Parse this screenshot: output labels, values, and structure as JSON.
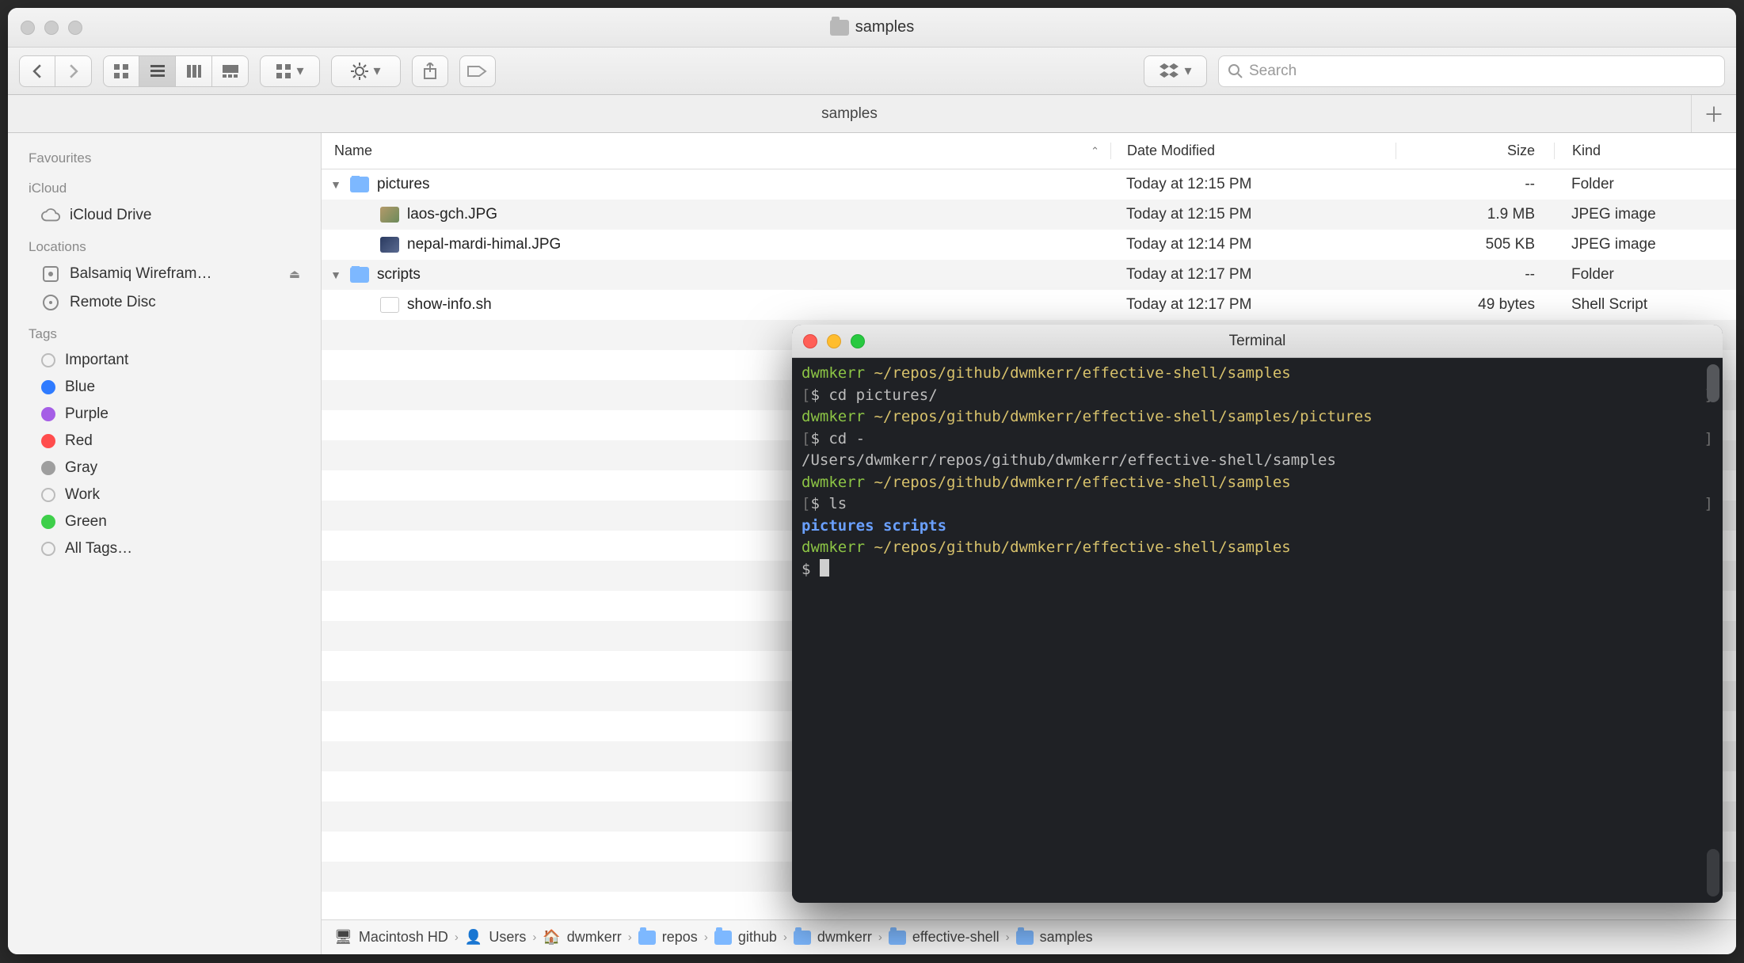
{
  "window": {
    "title": "samples"
  },
  "toolbar": {
    "search_placeholder": "Search"
  },
  "tabbar": {
    "active": "samples"
  },
  "sidebar": {
    "sections": {
      "favourites": "Favourites",
      "icloud": "iCloud",
      "locations": "Locations",
      "tags": "Tags"
    },
    "icloud_items": [
      {
        "label": "iCloud Drive"
      }
    ],
    "location_items": [
      {
        "label": "Balsamiq Wirefram…",
        "ejectable": true
      },
      {
        "label": "Remote Disc"
      }
    ],
    "tag_items": [
      {
        "label": "Important",
        "color": ""
      },
      {
        "label": "Blue",
        "color": "blue"
      },
      {
        "label": "Purple",
        "color": "purple"
      },
      {
        "label": "Red",
        "color": "red"
      },
      {
        "label": "Gray",
        "color": "gray"
      },
      {
        "label": "Work",
        "color": ""
      },
      {
        "label": "Green",
        "color": "green"
      },
      {
        "label": "All Tags…",
        "color": ""
      }
    ]
  },
  "columns": {
    "name": "Name",
    "date": "Date Modified",
    "size": "Size",
    "kind": "Kind"
  },
  "rows": [
    {
      "indent": 0,
      "disclose": "down",
      "icon": "folder",
      "name": "pictures",
      "date": "Today at 12:15 PM",
      "size": "--",
      "kind": "Folder"
    },
    {
      "indent": 1,
      "disclose": "",
      "icon": "img",
      "name": "laos-gch.JPG",
      "date": "Today at 12:15 PM",
      "size": "1.9 MB",
      "kind": "JPEG image"
    },
    {
      "indent": 1,
      "disclose": "",
      "icon": "img2",
      "name": "nepal-mardi-himal.JPG",
      "date": "Today at 12:14 PM",
      "size": "505 KB",
      "kind": "JPEG image"
    },
    {
      "indent": 0,
      "disclose": "down",
      "icon": "folder",
      "name": "scripts",
      "date": "Today at 12:17 PM",
      "size": "--",
      "kind": "Folder"
    },
    {
      "indent": 1,
      "disclose": "",
      "icon": "file",
      "name": "show-info.sh",
      "date": "Today at 12:17 PM",
      "size": "49 bytes",
      "kind": "Shell Script"
    }
  ],
  "path": [
    {
      "icon": "disk",
      "label": "Macintosh HD"
    },
    {
      "icon": "users",
      "label": "Users"
    },
    {
      "icon": "home",
      "label": "dwmkerr"
    },
    {
      "icon": "folder",
      "label": "repos"
    },
    {
      "icon": "folder",
      "label": "github"
    },
    {
      "icon": "folder",
      "label": "dwmkerr"
    },
    {
      "icon": "folder",
      "label": "effective-shell"
    },
    {
      "icon": "folder",
      "label": "samples"
    }
  ],
  "terminal": {
    "title": "Terminal",
    "user": "dwmkerr",
    "lines": {
      "p1_path": "~/repos/github/dwmkerr/effective-shell/samples",
      "c1": "cd pictures/",
      "p2_path": "~/repos/github/dwmkerr/effective-shell/samples/pictures",
      "c2": "cd -",
      "echo": "/Users/dwmkerr/repos/github/dwmkerr/effective-shell/samples",
      "p3_path": "~/repos/github/dwmkerr/effective-shell/samples",
      "c3": "ls",
      "ls_out1": "pictures",
      "ls_out2": "scripts",
      "p4_path": "~/repos/github/dwmkerr/effective-shell/samples",
      "prompt": "$"
    }
  }
}
